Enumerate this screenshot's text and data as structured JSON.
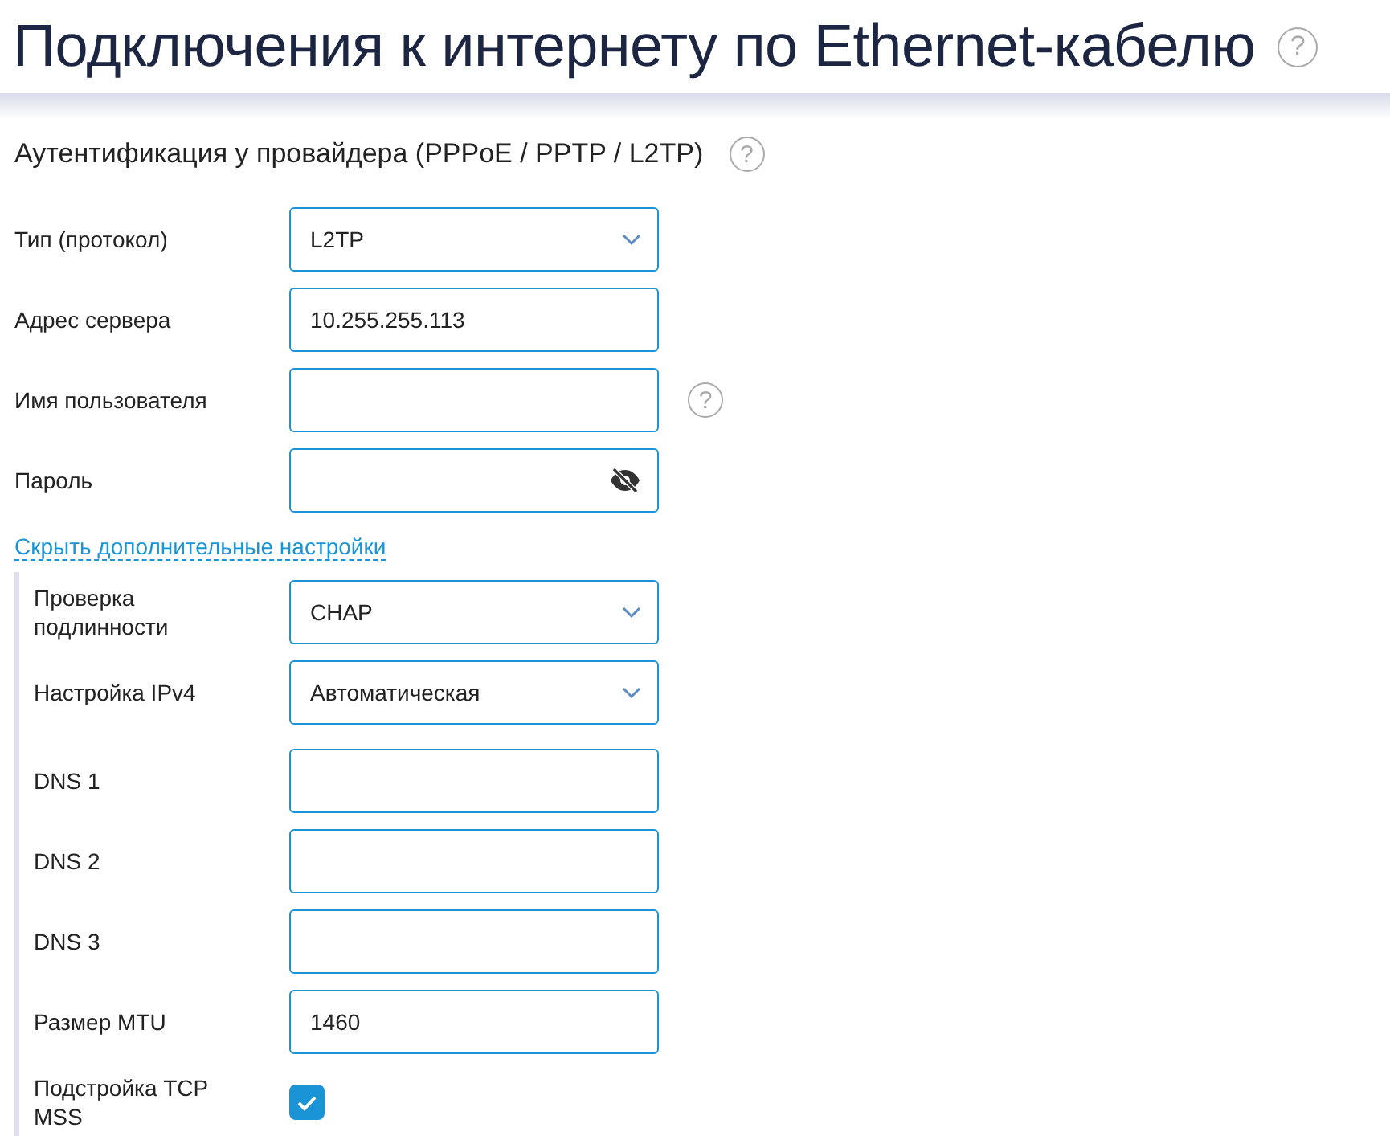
{
  "page": {
    "title": "Подключения к интернету по Ethernet-кабелю",
    "help": "?"
  },
  "section": {
    "title": "Аутентификация у провайдера (PPPoE / PPTP / L2TP)",
    "help": "?"
  },
  "fields": [
    {
      "label": "Тип (протокол)",
      "kind": "select",
      "value": "L2TP"
    },
    {
      "label": "Адрес сервера",
      "kind": "text",
      "value": "10.255.255.113"
    },
    {
      "label": "Имя пользователя",
      "kind": "text",
      "help": "?"
    },
    {
      "label": "Пароль",
      "kind": "password"
    }
  ],
  "advanced": {
    "link": "Скрыть дополнительные настройки",
    "expanded": true,
    "fields": [
      {
        "label": "Проверка подлинности",
        "kind": "select",
        "value": "CHAP"
      },
      {
        "label": "Настройка IPv4",
        "kind": "select",
        "value": "Автоматическая"
      },
      {
        "label": "DNS 1",
        "kind": "text"
      },
      {
        "label": "DNS 2",
        "kind": "text"
      },
      {
        "label": "DNS 3",
        "kind": "text"
      },
      {
        "label": "Размер MTU",
        "kind": "text",
        "value": "1460"
      },
      {
        "label": "Подстройка TCP MSS",
        "kind": "checkbox",
        "checked": true
      }
    ]
  }
}
